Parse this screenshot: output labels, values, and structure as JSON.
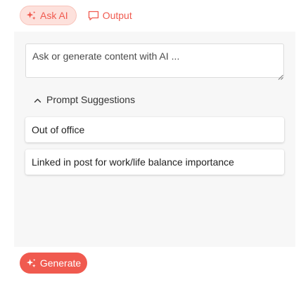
{
  "tabs": [
    {
      "label": "Ask AI",
      "icon": "sparkles-icon",
      "active": true
    },
    {
      "label": "Output",
      "icon": "chat-bubble-icon",
      "active": false
    }
  ],
  "prompt": {
    "placeholder": "Ask or generate content with AI ...",
    "value": ""
  },
  "suggestions": {
    "header": "Prompt Suggestions",
    "expanded": true,
    "items": [
      {
        "label": "Out of office"
      },
      {
        "label": "Linked in post for work/life balance importance"
      }
    ]
  },
  "generate": {
    "label": "Generate",
    "icon": "sparkles-icon"
  },
  "colors": {
    "accent": "#f05a4f",
    "accent_soft": "#fde1dc",
    "panel_bg": "#f7f7f7"
  }
}
